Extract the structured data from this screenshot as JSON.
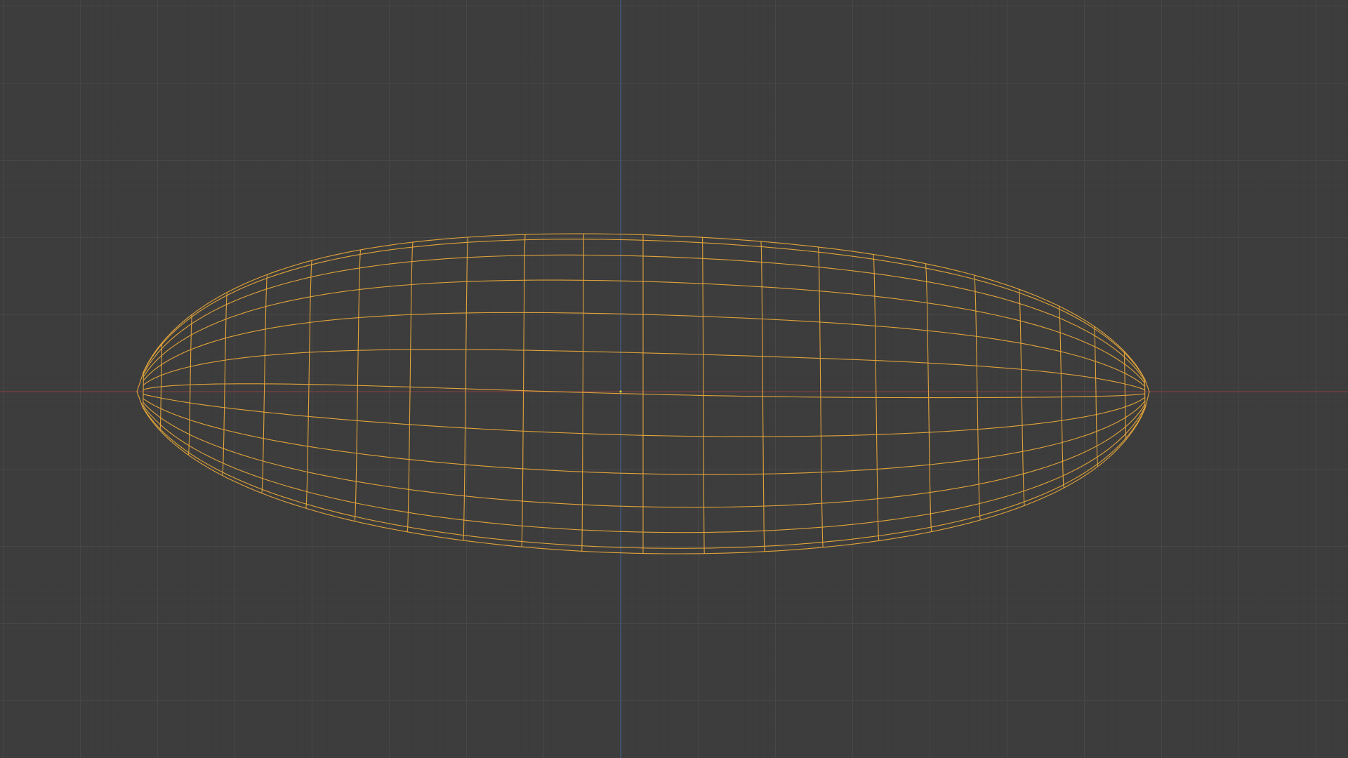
{
  "viewport": {
    "view": "top-orthographic",
    "mode": "wireframe",
    "background_color": "#3d3d3d",
    "grid_major_color": "#484848",
    "grid_minor_color": "#383838",
    "x_axis_color": "#7a4040",
    "y_axis_color": "#3f5f8a"
  },
  "object": {
    "state": "selected",
    "wire_color": "#e0a33a",
    "origin_color": "#c8d23c",
    "shape": "elongated ellipsoid mesh",
    "loop_count_long": 20,
    "loop_count_around": 12
  }
}
